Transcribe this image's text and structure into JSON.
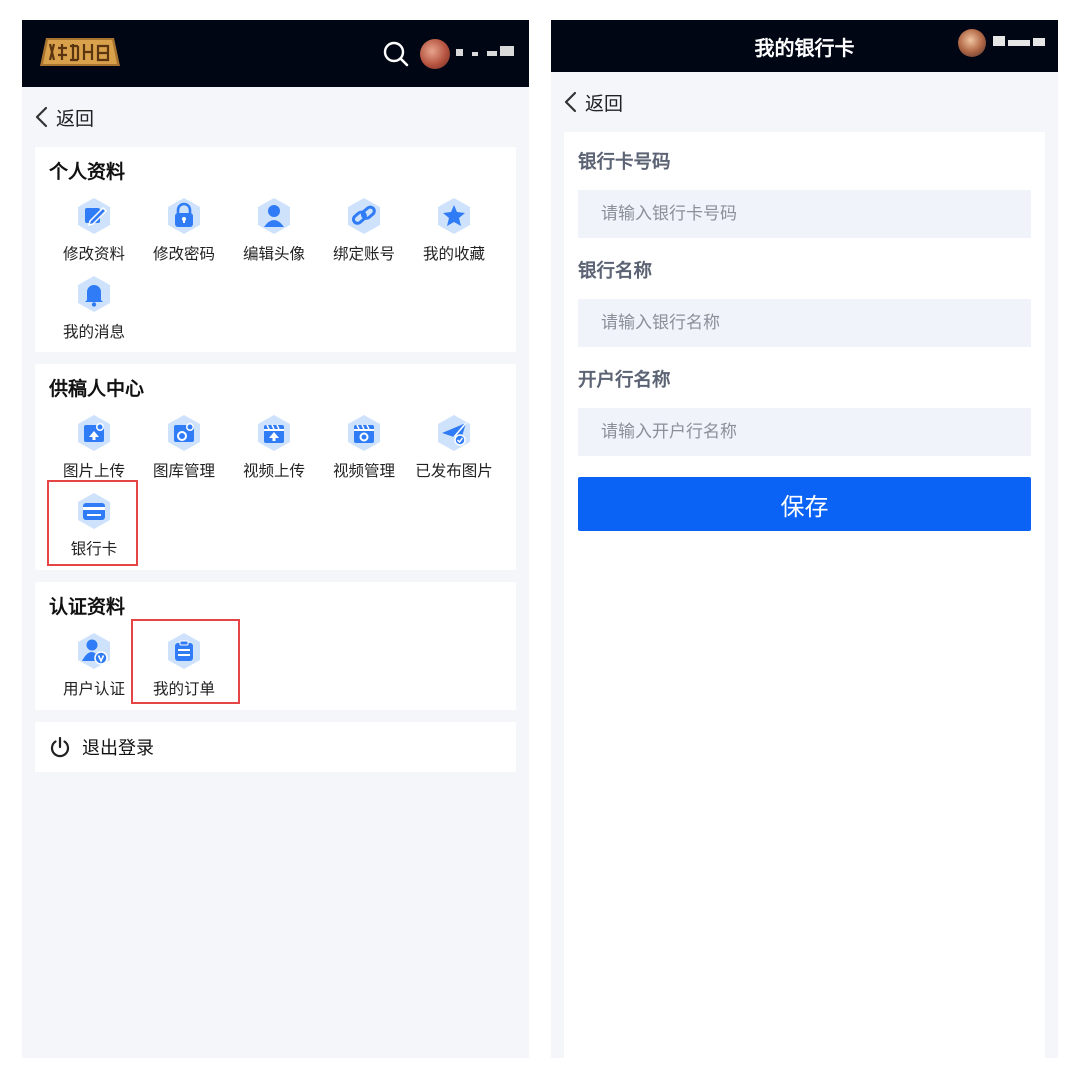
{
  "left": {
    "header": {
      "logo_icon": "site-logo",
      "search_icon": "search-icon",
      "avatar_icon": "user-avatar"
    },
    "back_label": "返回",
    "sections": [
      {
        "title": "个人资料",
        "items": [
          {
            "label": "修改资料",
            "icon": "edit-icon"
          },
          {
            "label": "修改密码",
            "icon": "lock-icon"
          },
          {
            "label": "编辑头像",
            "icon": "user-icon"
          },
          {
            "label": "绑定账号",
            "icon": "link-icon"
          },
          {
            "label": "我的收藏",
            "icon": "star-icon"
          },
          {
            "label": "我的消息",
            "icon": "bell-icon"
          }
        ]
      },
      {
        "title": "供稿人中心",
        "items": [
          {
            "label": "图片上传",
            "icon": "image-upload-icon"
          },
          {
            "label": "图库管理",
            "icon": "gallery-manage-icon"
          },
          {
            "label": "视频上传",
            "icon": "video-upload-icon"
          },
          {
            "label": "视频管理",
            "icon": "video-manage-icon"
          },
          {
            "label": "已发布图片",
            "icon": "send-icon"
          },
          {
            "label": "银行卡",
            "icon": "bank-card-icon"
          }
        ]
      },
      {
        "title": "认证资料",
        "items": [
          {
            "label": "用户认证",
            "icon": "verified-user-icon"
          },
          {
            "label": "我的订单",
            "icon": "order-icon"
          }
        ]
      }
    ],
    "logout_label": "退出登录"
  },
  "right": {
    "title": "我的银行卡",
    "back_label": "返回",
    "fields": [
      {
        "label": "银行卡号码",
        "placeholder": "请输入银行卡号码",
        "value": ""
      },
      {
        "label": "银行名称",
        "placeholder": "请输入银行名称",
        "value": ""
      },
      {
        "label": "开户行名称",
        "placeholder": "请输入开户行名称",
        "value": ""
      }
    ],
    "save_label": "保存"
  },
  "colors": {
    "header_bg": "#010614",
    "accent_blue": "#0b63f6",
    "icon_blue": "#2f7cf6",
    "icon_light": "#cfe2fc",
    "highlight_red": "#e64545",
    "page_bg": "#f4f6fa"
  }
}
